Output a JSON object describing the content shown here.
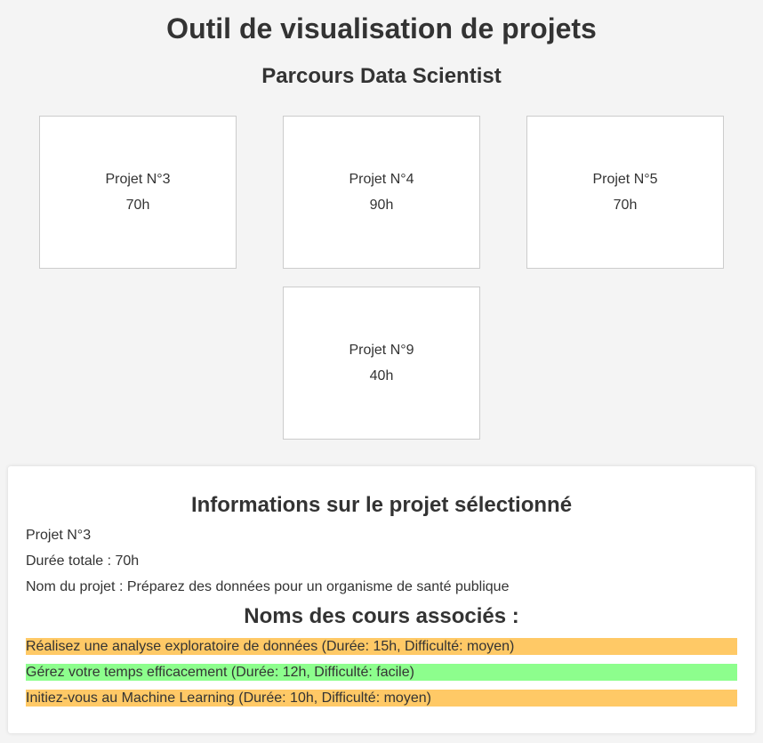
{
  "header": {
    "title": "Outil de visualisation de projets",
    "subtitle": "Parcours Data Scientist"
  },
  "projects": [
    {
      "name": "Projet N°3",
      "duration": "70h"
    },
    {
      "name": "Projet N°4",
      "duration": "90h"
    },
    {
      "name": "Projet N°5",
      "duration": "70h"
    },
    {
      "name": "Projet N°9",
      "duration": "40h"
    }
  ],
  "info": {
    "title": "Informations sur le projet sélectionné",
    "project": "Projet N°3",
    "duration": "Durée totale : 70h",
    "name": "Nom du projet : Préparez des données pour un organisme de santé publique",
    "courses_title": "Noms des cours associés :",
    "courses": [
      {
        "text": "Réalisez une analyse exploratoire de données (Durée: 15h, Difficulté: moyen)",
        "difficulty": "moyen",
        "color": "#ffc966"
      },
      {
        "text": "Gérez votre temps efficacement (Durée: 12h, Difficulté: facile)",
        "difficulty": "facile",
        "color": "#8dfe8d"
      },
      {
        "text": "Initiez-vous au Machine Learning (Durée: 10h, Difficulté: moyen)",
        "difficulty": "moyen",
        "color": "#ffc966"
      }
    ]
  },
  "colors": {
    "background": "#f4f4f4",
    "card": "#ffffff",
    "text": "#333333",
    "difficulty_medium": "#ffc966",
    "difficulty_easy": "#8dfe8d"
  }
}
